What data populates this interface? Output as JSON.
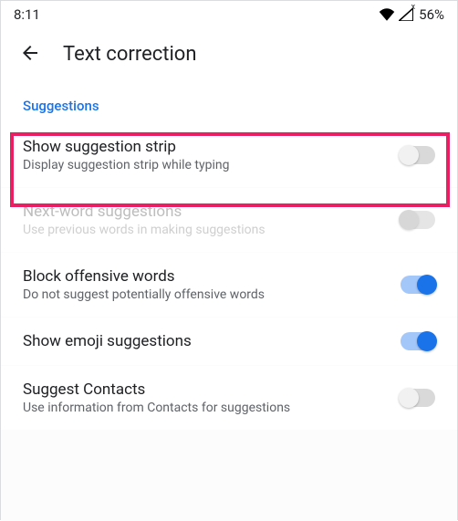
{
  "status": {
    "time": "8:11",
    "battery": "56%"
  },
  "header": {
    "title": "Text correction"
  },
  "section": {
    "label": "Suggestions"
  },
  "rows": [
    {
      "title": "Show suggestion strip",
      "sub": "Display suggestion strip while typing"
    },
    {
      "title": "Next-word suggestions",
      "sub": "Use previous words in making suggestions"
    },
    {
      "title": "Block offensive words",
      "sub": "Do not suggest potentially offensive words"
    },
    {
      "title": "Show emoji suggestions",
      "sub": ""
    },
    {
      "title": "Suggest Contacts",
      "sub": "Use information from Contacts for suggestions"
    }
  ]
}
